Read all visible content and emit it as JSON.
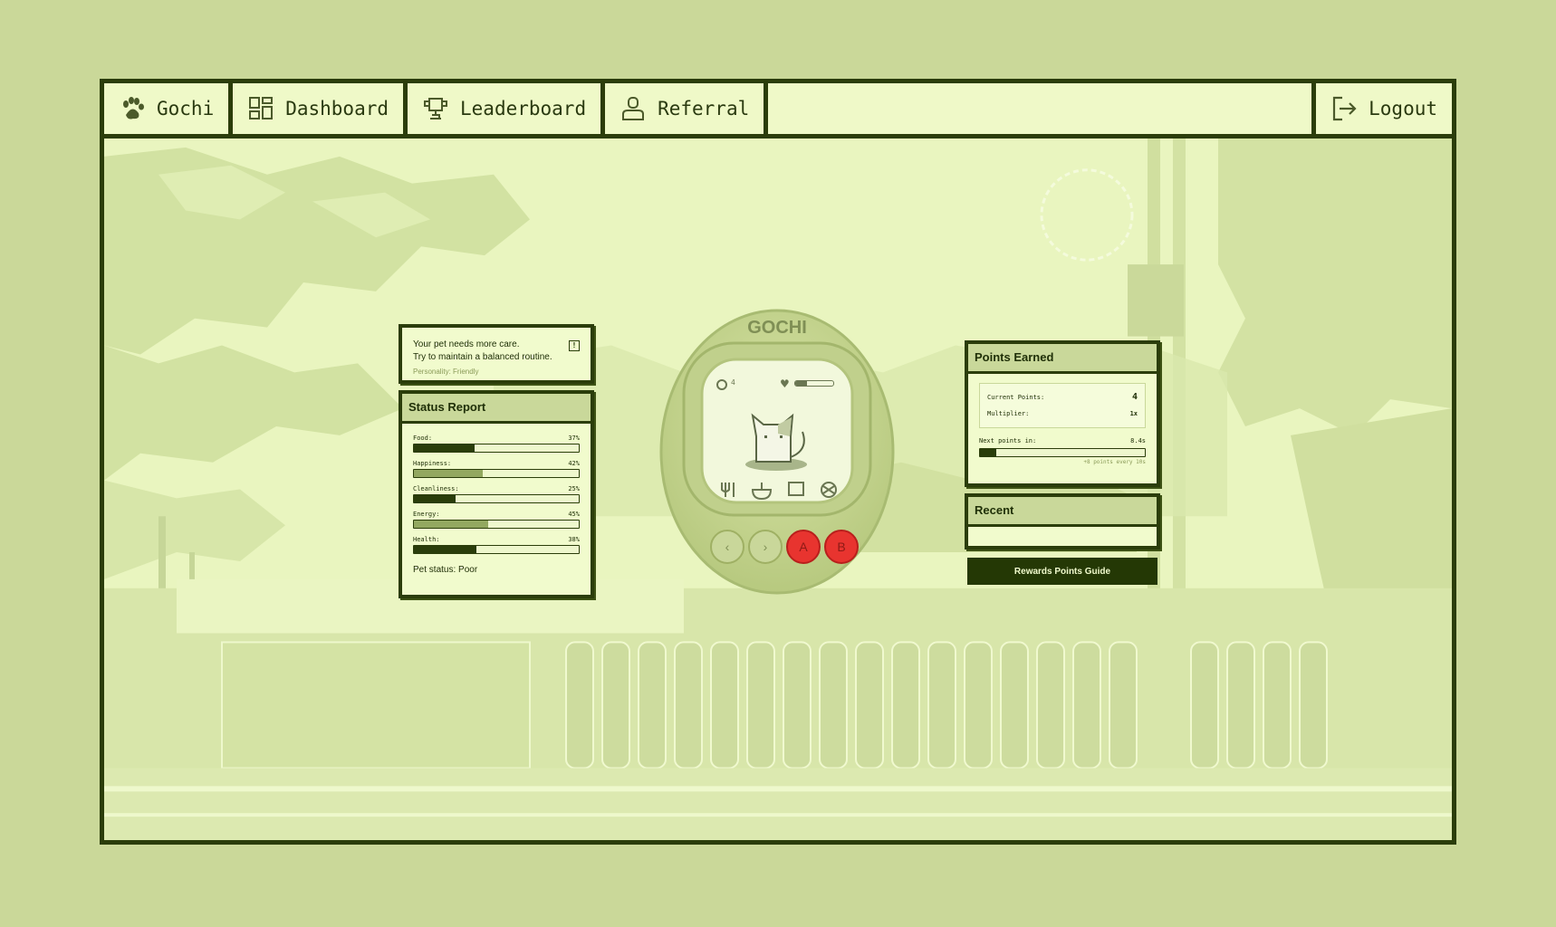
{
  "nav": {
    "items": [
      {
        "label": "Gochi",
        "icon": "paw-icon"
      },
      {
        "label": "Dashboard",
        "icon": "dashboard-icon"
      },
      {
        "label": "Leaderboard",
        "icon": "trophy-icon"
      },
      {
        "label": "Referral",
        "icon": "user-icon"
      }
    ],
    "logout": {
      "label": "Logout",
      "icon": "logout-icon"
    }
  },
  "message": {
    "line1": "Your pet needs more care.",
    "line2": "Try to maintain a balanced routine.",
    "personality": "Personality: Friendly",
    "alert_glyph": "!"
  },
  "status_report": {
    "title": "Status Report",
    "stats": [
      {
        "label": "Food:",
        "value": "37%",
        "level": 0.37,
        "style": "dark"
      },
      {
        "label": "Happiness:",
        "value": "42%",
        "level": 0.42,
        "style": "light"
      },
      {
        "label": "Cleanliness:",
        "value": "25%",
        "level": 0.25,
        "style": "dark"
      },
      {
        "label": "Energy:",
        "value": "45%",
        "level": 0.45,
        "style": "light"
      },
      {
        "label": "Health:",
        "value": "38%",
        "level": 0.38,
        "style": "dark"
      }
    ],
    "pet_status": "Pet status: Poor"
  },
  "device": {
    "brand": "GOCHI",
    "coins": "4",
    "health_level": 0.3,
    "buttons": {
      "a": "A",
      "b": "B"
    }
  },
  "points": {
    "title": "Points Earned",
    "current_label": "Current Points:",
    "current_value": "4",
    "multiplier_label": "Multiplier:",
    "multiplier_value": "1x",
    "next_label": "Next points in:",
    "next_value": "8.4s",
    "next_progress": 0.1,
    "note": "+8 points every 10s"
  },
  "recent": {
    "title": "Recent"
  },
  "rewards_button": "Rewards Points Guide",
  "colors": {
    "dark": "#2b3d0a",
    "panel": "#f1fbcd",
    "header": "#c9d89a",
    "accent_red": "#e8342f"
  }
}
